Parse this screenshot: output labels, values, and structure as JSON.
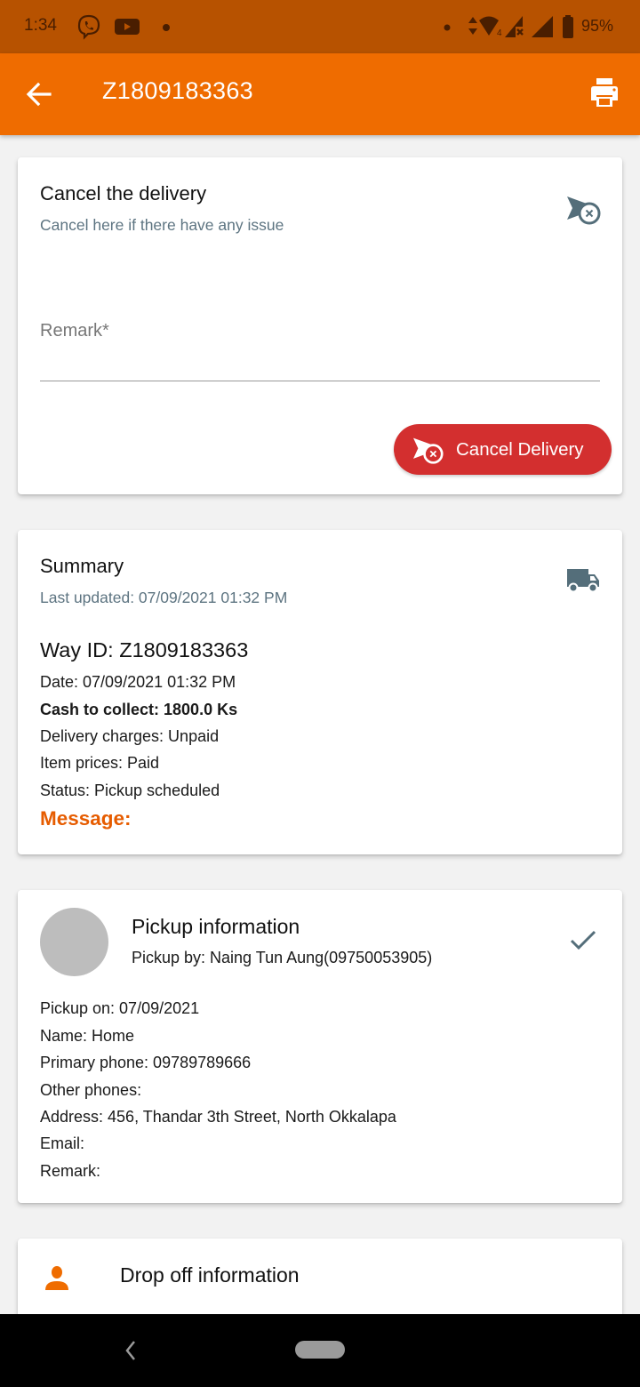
{
  "status_bar": {
    "time": "1:34",
    "battery": "95%",
    "icons": [
      "viber-icon",
      "youtube-icon",
      "notification-dot-icon",
      "data-arrows-icon",
      "wifi-icon",
      "signal-no-service-icon",
      "signal-icon",
      "battery-icon"
    ]
  },
  "app_bar": {
    "title": "Z1809183363",
    "back_icon": "arrow-back-icon",
    "print_icon": "printer-icon"
  },
  "cancel_card": {
    "title": "Cancel the delivery",
    "subtitle": "Cancel here if there have any issue",
    "icon": "cancel-delivery-icon",
    "remark_label": "Remark*",
    "remark_value": "",
    "button_label": "Cancel Delivery"
  },
  "summary_card": {
    "title": "Summary",
    "last_updated": "Last updated: 07/09/2021 01:32 PM",
    "icon": "truck-icon",
    "way_id": "Way ID: Z1809183363",
    "date": "Date: 07/09/2021 01:32 PM",
    "cash_to_collect": "Cash to collect: 1800.0 Ks",
    "delivery_charges": "Delivery charges: Unpaid",
    "item_prices": "Item prices: Paid",
    "status": "Status: Pickup scheduled",
    "message_label": "Message:"
  },
  "pickup_card": {
    "title": "Pickup information",
    "pickup_by": "Pickup by: Naing Tun Aung(09750053905)",
    "icon": "check-icon",
    "lines": [
      "Pickup on: 07/09/2021",
      "Name: Home",
      "Primary phone: 09789789666",
      "Other phones:",
      "Address: 456, Thandar 3th Street, North Okkalapa",
      "Email:",
      "Remark:"
    ]
  },
  "dropoff_card": {
    "title": "Drop off information",
    "icon": "person-icon"
  },
  "colors": {
    "status_bar": "#b75200",
    "app_bar": "#ef6c00",
    "cancel_button": "#d32f2f",
    "icon_gray": "#546e7a",
    "message": "#e65c00"
  }
}
